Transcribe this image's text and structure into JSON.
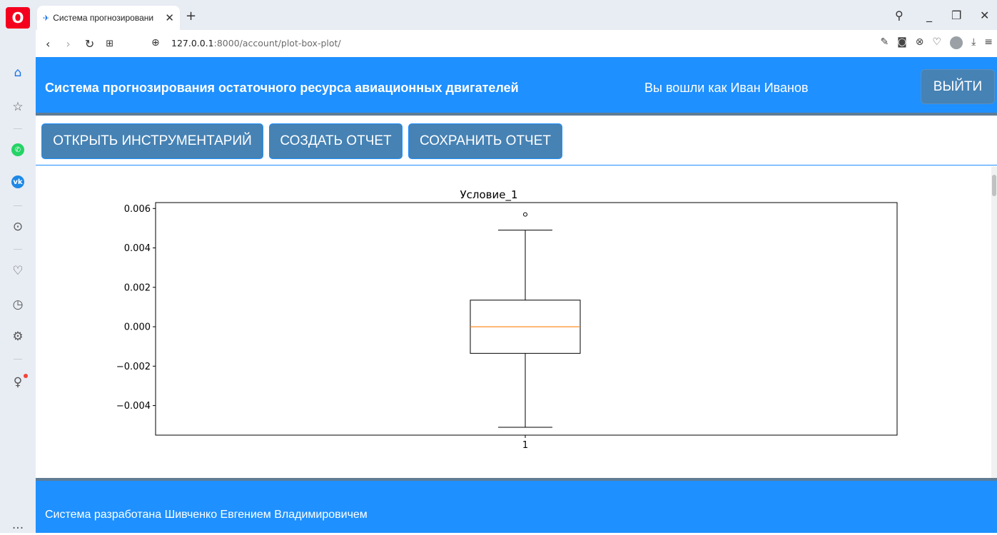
{
  "browser": {
    "tab_title": "Система прогнозировани",
    "url_host": "127.0.0.1",
    "url_rest": ":8000/account/plot-box-plot/",
    "sidebar_more": "..."
  },
  "header": {
    "title": "Система прогнозирования остаточного ресурса авиационных двигателей",
    "user_text": "Вы вошли как Иван Иванов",
    "logout_label": "ВЫЙТИ"
  },
  "toolbar": {
    "open_tools_label": "ОТКРЫТЬ ИНСТРУМЕНТАРИЙ",
    "create_report_label": "СОЗДАТЬ ОТЧЕТ",
    "save_report_label": "СОХРАНИТЬ ОТЧЕТ"
  },
  "chart_data": {
    "type": "box",
    "title": "Условие_1",
    "categories": [
      "1"
    ],
    "yticks": [
      "0.006",
      "0.004",
      "0.002",
      "0.000",
      "−0.002",
      "−0.004"
    ],
    "ytick_values": [
      0.006,
      0.004,
      0.002,
      0.0,
      -0.002,
      -0.004
    ],
    "ylim": [
      -0.0055,
      0.0063
    ],
    "box": {
      "whisker_low": -0.0051,
      "q1": -0.00135,
      "median": 0.0,
      "q3": 0.00135,
      "whisker_high": 0.0049,
      "outliers": [
        0.0057
      ]
    },
    "colors": {
      "box": "#000000",
      "median": "#ff7f0e"
    }
  },
  "footer": {
    "text": "Система разработана Шивченко Евгением Владимировичем"
  }
}
